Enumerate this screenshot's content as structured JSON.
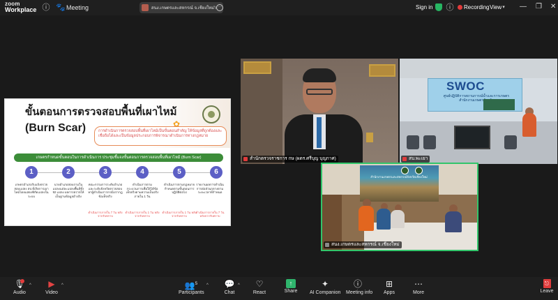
{
  "titlebar": {
    "logo_line1": "zoom",
    "logo_line2": "Workplace",
    "meeting_label": "Meeting",
    "share_pill_text": "สนง.เกษตรและสหกรณ์ จ.เชียงใหม่'s scree",
    "sign_in": "Sign in",
    "recording": "Recording",
    "view": "View"
  },
  "slide": {
    "title_line1": "ขั้นตอนการตรวจสอบพื้นที่เผาไหม้",
    "title_line2": "(Burn Scar)",
    "note": "การดำเนินการตรวจสอบพื้นที่เผาไหม้เป็นขั้นตอนสำคัญ ให้ข้อมูลที่ถูกต้องและเชื่อถือได้และเป็นข้อมูลประกอบการพิจารณาดำเนินการทางกฎหมาย",
    "bar_text": "เกษตรกำหนดขั้นตอนในการดำเนินการ ประชุมชี้แจงขั้นตอนการตรวจสอบพื้นที่เผาไหม้ (Burn Scar)",
    "steps": [
      {
        "num": "1",
        "text": "เกษตรอำเภอรับแจ้งตรวจสอบแปลง สป.ที่เกิดการเผาไหม้โดยแสดงพิกัดแปลงในระบบ",
        "time": ""
      },
      {
        "num": "2",
        "text": "นายอำเภอสอบถามในแปลงแต่ละแปลงพื้นที่ทั้ง 92 แปลง ผลการตรวจให้เป็นฐานข้อมูลอ้างอิง",
        "time": ""
      },
      {
        "num": "3",
        "text": "คณะกรรมการระดับอำเภอและระดับจังหวัดตรวจสอบหาผู้ดำเนินการกรณีปรากฏข้อเท็จจริง",
        "time": "ดำเนินการภายใน 7 วัน หลังจากรับทราบ"
      },
      {
        "num": "4",
        "text": "ดำเนินการตามกระบวนการเพื่อให้ได้ข้อเท็จจริงตามความเป็นจริง ภายใน 1 วัน",
        "time": "ดำเนินการภายใน 1 วัน หลังจากรับทราบ"
      },
      {
        "num": "5",
        "text": "ดำเนินการตามกฎหมายกำหนดตามขั้นตอนการปฏิบัติต่อไป",
        "time": "ดำเนินการภายใน 1 วัน หลังจากรับทราบ"
      },
      {
        "num": "6",
        "text": "รายงานผลการดำเนินการต่อส่วนกลางตามระยะเวลาที่กำหนด",
        "time": "ดำเนินการภายใน 7 วัน หลังจากรับทราบ"
      }
    ]
  },
  "tiles": {
    "tile1_name": "สำนักตรวจราชการ กษ (ผตร.ศรีบุญ บุญกาศ)",
    "tile2_name": "สบ.พะเยา",
    "tile2_banner": "SWOC",
    "tile2_sub": "ศูนย์ปฏิบัติการสถานการณ์น้ำและการเกษตร สำนักงานเกษตรจังหวัด",
    "tile3_name": "สนง.เกษตรและสหกรณ์ จ.เชียงใหม่",
    "tile3_poster": "สำนักงานเกษตรและสหกรณ์จังหวัดเชียงใหม่"
  },
  "toolbar": {
    "audio": "Audio",
    "video": "Video",
    "participants": "Participants",
    "participants_count": "5",
    "chat": "Chat",
    "react": "React",
    "share": "Share",
    "ai_companion": "AI Companion",
    "meeting_info": "Meeting info",
    "apps": "Apps",
    "more": "More",
    "leave": "Leave"
  },
  "colors": {
    "accent_green": "#2fb56d",
    "record_red": "#e23b3b",
    "step_purple": "#5c5fc5",
    "bar_green": "#3c8d39"
  }
}
